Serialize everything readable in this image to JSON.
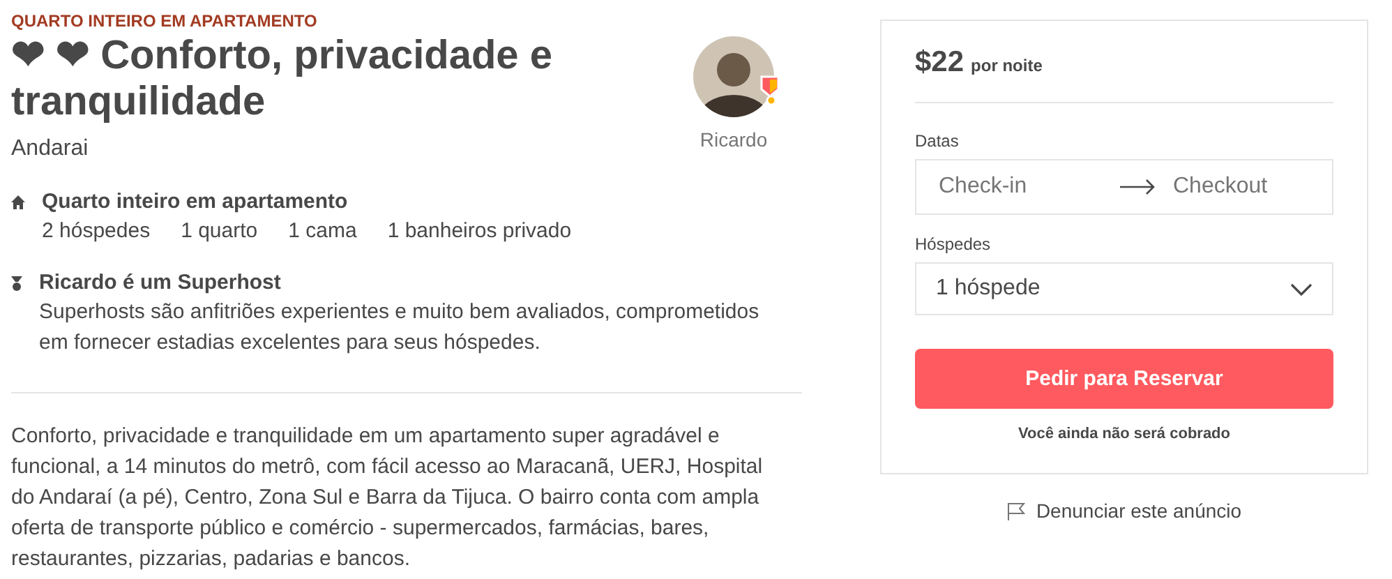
{
  "listing": {
    "category": "QUARTO INTEIRO EM APARTAMENTO",
    "title": "❤ ❤ Conforto, privacidade e tranquilidade",
    "location": "Andarai",
    "host": {
      "name": "Ricardo"
    },
    "highlights": [
      {
        "kind": "home",
        "title": "Quarto inteiro em apartamento",
        "details": [
          "2 hóspedes",
          "1 quarto",
          "1 cama",
          "1 banheiros privado"
        ]
      },
      {
        "kind": "medal",
        "title": "Ricardo é um Superhost",
        "text": "Superhosts são anfitriões experientes e muito bem avaliados, comprometidos em fornecer estadias excelentes para seus hóspedes."
      }
    ],
    "description": "Conforto, privacidade e tranquilidade em um apartamento super agradável e funcional, a 14 minutos do metrô, com fácil acesso ao Maracanã, UERJ, Hospital do Andaraí (a pé), Centro, Zona Sul e Barra da Tijuca. O bairro conta com ampla oferta de transporte público e comércio - supermercados, farmácias, bares, restaurantes, pizzarias, padarias e bancos."
  },
  "booking": {
    "price": "$22",
    "per": "por noite",
    "dates_label": "Datas",
    "checkin": {
      "placeholder": "Check-in"
    },
    "checkout": {
      "placeholder": "Checkout"
    },
    "guests_label": "Hóspedes",
    "guests": "1 hóspede",
    "button": "Pedir para Reservar",
    "note": "Você ainda não será cobrado"
  },
  "report": "Denunciar este anúncio"
}
